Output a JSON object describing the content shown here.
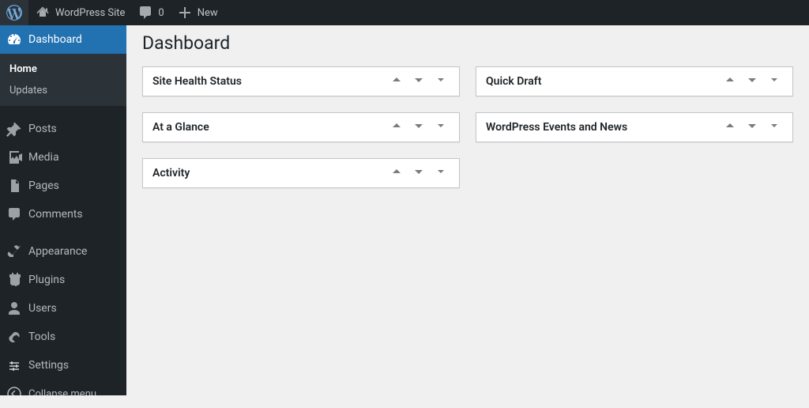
{
  "adminbar": {
    "site_name": "WordPress Site",
    "comments_count": "0",
    "new_label": "New"
  },
  "sidebar": {
    "items": [
      {
        "label": "Dashboard"
      },
      {
        "label": "Posts"
      },
      {
        "label": "Media"
      },
      {
        "label": "Pages"
      },
      {
        "label": "Comments"
      },
      {
        "label": "Appearance"
      },
      {
        "label": "Plugins"
      },
      {
        "label": "Users"
      },
      {
        "label": "Tools"
      },
      {
        "label": "Settings"
      }
    ],
    "dashboard_submenu": [
      {
        "label": "Home"
      },
      {
        "label": "Updates"
      }
    ],
    "collapse_label": "Collapse menu"
  },
  "page": {
    "title": "Dashboard"
  },
  "panels": {
    "col1": [
      {
        "title": "Site Health Status"
      },
      {
        "title": "At a Glance"
      },
      {
        "title": "Activity"
      }
    ],
    "col2": [
      {
        "title": "Quick Draft"
      },
      {
        "title": "WordPress Events and News"
      }
    ]
  }
}
